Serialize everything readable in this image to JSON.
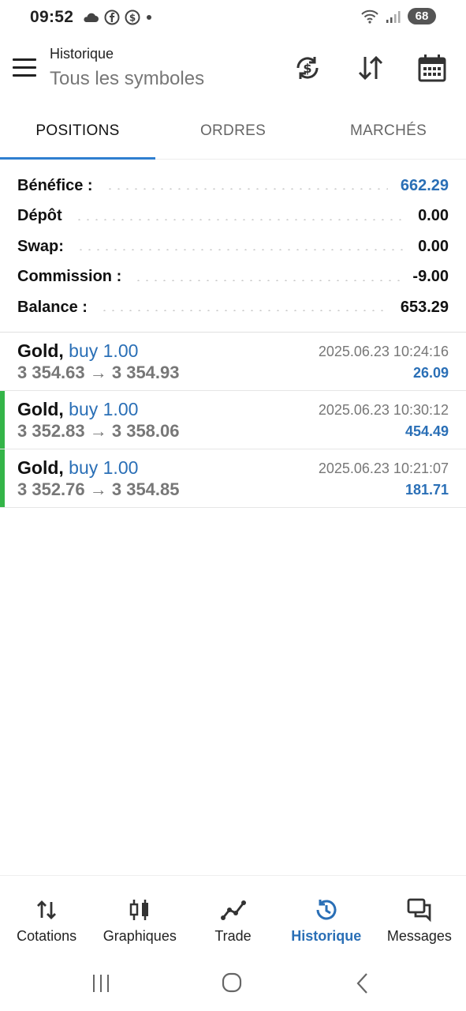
{
  "status_bar": {
    "time": "09:52",
    "battery": "68",
    "icons": [
      "cloud-icon",
      "facebook-icon",
      "dollar-circle-icon",
      "dot-icon",
      "wifi-icon",
      "signal-icon"
    ]
  },
  "header": {
    "title": "Historique",
    "subtitle": "Tous les symboles",
    "actions": [
      "currency-exchange-icon",
      "sort-icon",
      "calendar-icon"
    ]
  },
  "tabs": [
    {
      "label": "POSITIONS",
      "active": true
    },
    {
      "label": "ORDRES",
      "active": false
    },
    {
      "label": "MARCHÉS",
      "active": false
    }
  ],
  "summary": [
    {
      "label": "Bénéfice :",
      "value": "662.29",
      "highlight": true
    },
    {
      "label": "Dépôt",
      "value": "0.00",
      "highlight": false
    },
    {
      "label": "Swap:",
      "value": "0.00",
      "highlight": false
    },
    {
      "label": "Commission :",
      "value": "-9.00",
      "highlight": false
    },
    {
      "label": "Balance :",
      "value": "653.29",
      "highlight": false
    }
  ],
  "trades": [
    {
      "symbol": "Gold,",
      "side": "buy 1.00",
      "prices": "3 354.63 → 3 354.93",
      "datetime": "2025.06.23 10:24:16",
      "profit": "26.09",
      "marker": false
    },
    {
      "symbol": "Gold,",
      "side": "buy 1.00",
      "prices": "3 352.83 → 3 358.06",
      "datetime": "2025.06.23 10:30:12",
      "profit": "454.49",
      "marker": true
    },
    {
      "symbol": "Gold,",
      "side": "buy 1.00",
      "prices": "3 352.76 → 3 354.85",
      "datetime": "2025.06.23 10:21:07",
      "profit": "181.71",
      "marker": true
    }
  ],
  "bottom_nav": [
    {
      "label": "Cotations",
      "icon": "quotes-arrows-icon",
      "active": false
    },
    {
      "label": "Graphiques",
      "icon": "candlestick-chart-icon",
      "active": false
    },
    {
      "label": "Trade",
      "icon": "trade-line-icon",
      "active": false
    },
    {
      "label": "Historique",
      "icon": "history-clock-icon",
      "active": true
    },
    {
      "label": "Messages",
      "icon": "messages-icon",
      "active": false
    }
  ],
  "colors": {
    "accent": "#2a6fb6",
    "tab_indicator": "#2f7fd0",
    "profit_marker": "#34b548"
  }
}
